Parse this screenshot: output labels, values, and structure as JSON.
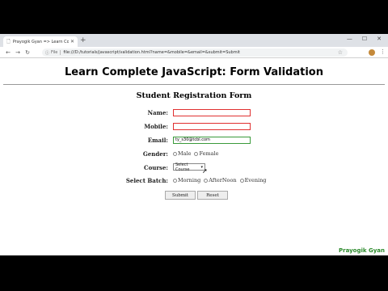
{
  "browser": {
    "tab_title": "Prayogik Gyan => Learn Complete",
    "new_tab": "+",
    "scheme": "File",
    "url": "file:///D:/tutorials/javascript/validation.html?name=&mobile=&email=&submit=Submit",
    "window_controls": [
      "—",
      "☐",
      "✕"
    ]
  },
  "page": {
    "main_heading": "Learn Complete JavaScript: Form Validation",
    "form_heading": "Student Registration Form",
    "labels": {
      "name": "Name:",
      "mobile": "Mobile:",
      "email": "Email:",
      "gender": "Gender:",
      "course": "Course:",
      "batch": "Select Batch:"
    },
    "fields": {
      "name_value": "",
      "mobile_value": "",
      "email_value": "ty_s30@tcbl.com"
    },
    "gender_options": [
      "Male",
      "Female"
    ],
    "course_selected": "Select Course",
    "batch_options": [
      "Morning",
      "AfterNoon",
      "Evening"
    ],
    "buttons": {
      "submit": "Submit",
      "reset": "Reset"
    },
    "footer_brand": "Prayogik Gyan"
  },
  "colors": {
    "error_border": "#e03030",
    "valid_border": "#3a9a3a",
    "brand": "#2c8a2c"
  }
}
